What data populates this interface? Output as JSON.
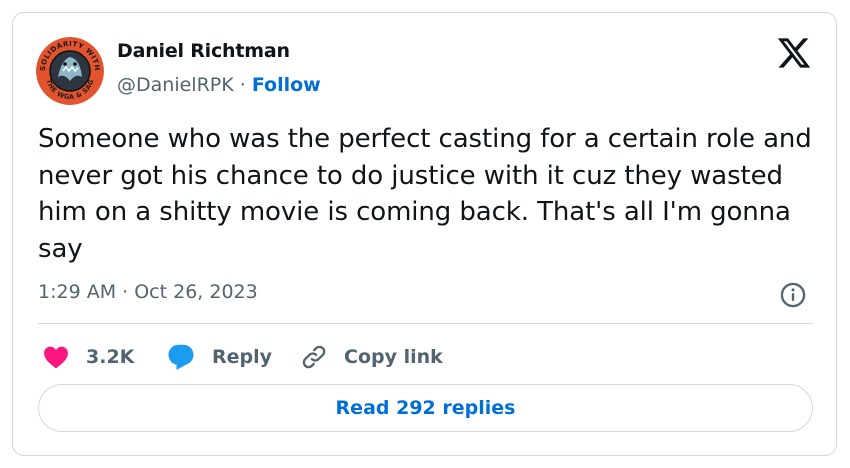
{
  "author": {
    "name": "Daniel Richtman",
    "handle": "@DanielRPK",
    "separator": " · ",
    "follow_label": "Follow",
    "avatar_badge_top": "SOLIDARITY WITH",
    "avatar_badge_bottom": "THE WGA & SAG"
  },
  "tweet": {
    "text": "Someone who was the perfect casting for a certain role and never got his chance to do justice with it cuz they wasted him on a shitty movie is coming back. That's all I'm gonna say",
    "timestamp": "1:29 AM · Oct 26, 2023"
  },
  "actions": {
    "like_count": "3.2K",
    "reply_label": "Reply",
    "copy_link_label": "Copy link"
  },
  "read_replies_label": "Read 292 replies",
  "icons": {
    "logo": "x-logo-icon",
    "info": "info-icon",
    "like": "heart-icon",
    "reply": "speech-bubble-icon",
    "copy": "link-icon"
  },
  "colors": {
    "link_blue": "#006fd6",
    "heart_pink": "#f91880",
    "reply_blue": "#1d9bf0",
    "secondary_text": "#536471",
    "avatar_ring": "#e2532e"
  }
}
